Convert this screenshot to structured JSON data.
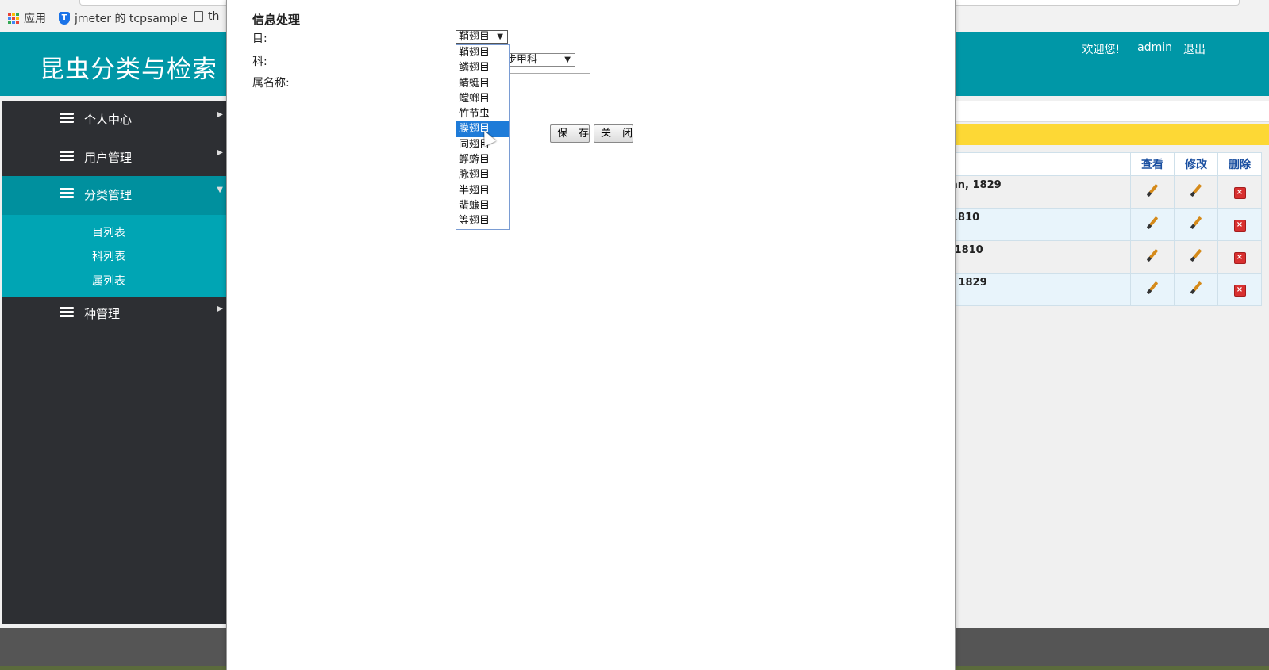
{
  "browser": {
    "bookmarks": [
      {
        "label": "应用"
      },
      {
        "label": "jmeter 的 tcpsample"
      },
      {
        "label": "th"
      }
    ]
  },
  "header": {
    "title": "昆虫分类与检索",
    "welcome": "欢迎您!",
    "username": "admin",
    "logout": "退出"
  },
  "sidebar": {
    "items": [
      {
        "label": "个人中心"
      },
      {
        "label": "用户管理"
      },
      {
        "label": "分类管理"
      },
      {
        "label": "种管理"
      }
    ],
    "submenu": [
      {
        "label": "目列表"
      },
      {
        "label": "科列表"
      },
      {
        "label": "属列表"
      }
    ]
  },
  "table": {
    "headers": [
      "查看",
      "修改",
      "删除"
    ],
    "rows": [
      {
        "text": "an, 1829"
      },
      {
        "text": "1810"
      },
      {
        "text": " 1810"
      },
      {
        "text": ", 1829"
      }
    ]
  },
  "modal": {
    "title": "信息处理",
    "order_label": "目:",
    "family_label": "科:",
    "genus_label": "属名称:",
    "order_value": "鞘翅目",
    "family_value": "步甲科",
    "genus_value": "",
    "save_label": "保 存",
    "close_label": "关 闭",
    "order_options": [
      "鞘翅目",
      "鳞翅目",
      "蜻蜓目",
      "螳螂目",
      "竹节虫",
      "膜翅目",
      "同翅目",
      "蜉蝣目",
      "脉翅目",
      "半翅目",
      "蜚蠊目",
      "等翅目"
    ],
    "highlighted_option": "膜翅目"
  },
  "colors": {
    "header": "#0097a7",
    "sidebar": "#2d2f33",
    "sidebar_active": "#00909e",
    "submenu": "#00a5b4",
    "highlight": "#fdd835",
    "dropdown_selected": "#1e7bd8"
  }
}
